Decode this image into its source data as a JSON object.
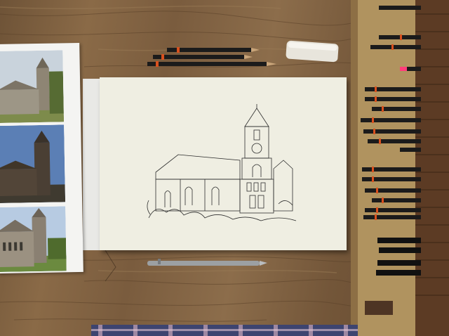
{
  "scene": {
    "description_free": true,
    "colors": {
      "table_wood": "#7a5c3e",
      "drawing_paper": "#efeee2",
      "pencil_case": "#a88a5c",
      "pencil_body": "#1b1b1b",
      "pencil_band": "#d8501e",
      "pink_tip": "#ff3d7a"
    },
    "items": {
      "photo_sheet": "photo-reference-sheet",
      "drawing": "church-sketch",
      "eraser": "eraser",
      "mechanical_pencil": "mechanical-pencil",
      "pencil_case": "pencil-roll-case"
    }
  }
}
